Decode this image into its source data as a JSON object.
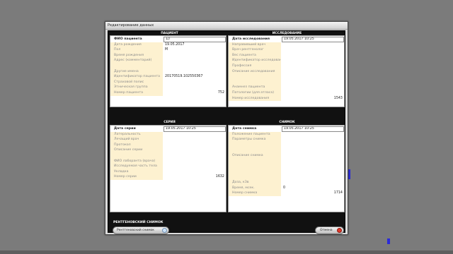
{
  "window": {
    "title": "Редактирование данных"
  },
  "sections": {
    "patient": "ПАЦИЕНТ",
    "study": "ИССЛЕДОВАНИЕ",
    "series": "СЕРИЯ",
    "image": "СНИМОК",
    "xray": "РЕНТГЕНОВСКИЙ СНИМОК"
  },
  "patient": {
    "rows": [
      {
        "label": "ФИО пациента",
        "value": "1//"
      },
      {
        "label": "Дата рождения",
        "value": "19.05.2017"
      },
      {
        "label": "Пол",
        "value": "M"
      },
      {
        "label": "Время рождения",
        "value": ""
      },
      {
        "label": "Адрес (комментарий)",
        "value": ""
      },
      {
        "label": "",
        "value": ""
      },
      {
        "label": "Другие имена",
        "value": ""
      },
      {
        "label": "Идентификатор пациента",
        "value": "20170519.102550367"
      },
      {
        "label": "Страховой полис",
        "value": ""
      },
      {
        "label": "Этническая группа",
        "value": ""
      },
      {
        "label": "Номер пациента",
        "value": "752"
      }
    ]
  },
  "study": {
    "rows": [
      {
        "label": "Дата исследования",
        "value": "19.05.2017 10:25"
      },
      {
        "label": "Направивший врач",
        "value": ""
      },
      {
        "label": "Врач рентгенолог",
        "value": ""
      },
      {
        "label": "Вес пациента",
        "value": ""
      },
      {
        "label": "Идентификатор исследования",
        "value": ""
      },
      {
        "label": "Профессия",
        "value": ""
      },
      {
        "label": "Описание исследования",
        "value": ""
      },
      {
        "label": "",
        "value": ""
      },
      {
        "label": "",
        "value": ""
      },
      {
        "label": "Анамнез пациента",
        "value": ""
      },
      {
        "label": "Патологии (для атласа)",
        "value": ""
      },
      {
        "label": "Номер исследования",
        "value": "1543"
      }
    ]
  },
  "series": {
    "rows": [
      {
        "label": "Дата серии",
        "value": "19.05.2017 10:25"
      },
      {
        "label": "Латеральность",
        "value": ""
      },
      {
        "label": "Лечащий врач",
        "value": ""
      },
      {
        "label": "Протокол",
        "value": ""
      },
      {
        "label": "Описание серии",
        "value": ""
      },
      {
        "label": "",
        "value": ""
      },
      {
        "label": "ФИО лаборанта (врача)",
        "value": ""
      },
      {
        "label": "Исследуемая часть тела",
        "value": ""
      },
      {
        "label": "Укладка",
        "value": ""
      },
      {
        "label": "Номер серии",
        "value": "1632"
      }
    ]
  },
  "image": {
    "rows": [
      {
        "label": "Дата снимка",
        "value": "19.05.2017 10:25"
      },
      {
        "label": "Положение пациента",
        "value": ""
      },
      {
        "label": "Параметры снимка",
        "value": ""
      },
      {
        "label": "",
        "value": ""
      },
      {
        "label": "",
        "value": ""
      },
      {
        "label": "Описание снимка",
        "value": ""
      },
      {
        "label": "",
        "value": ""
      },
      {
        "label": "",
        "value": ""
      },
      {
        "label": "",
        "value": ""
      },
      {
        "label": "",
        "value": ""
      },
      {
        "label": "Доза, кЗв",
        "value": ""
      },
      {
        "label": "Время, мсек.",
        "value": "0"
      },
      {
        "label": "Номер снимка",
        "value": "1714"
      }
    ]
  },
  "buttons": {
    "xray": "Рентгеновский снимок",
    "cancel": "Отмена"
  },
  "colors": {
    "label_bg": "#fdf1d0",
    "panel_bg": "#ffffff",
    "dialog_bg": "#111111",
    "accent_marker": "#2a2ad8",
    "cancel_icon": "#e23a2a"
  },
  "icons": {
    "xray_button": "arrow-right-icon",
    "cancel_button": "cancel-icon"
  }
}
